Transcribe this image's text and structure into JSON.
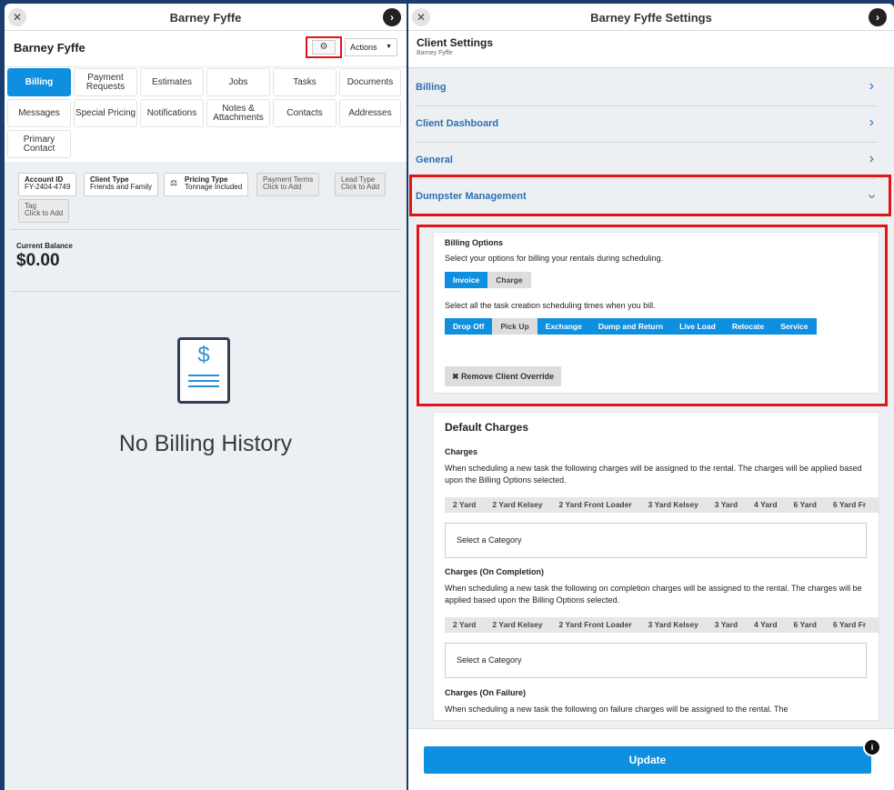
{
  "left": {
    "title": "Barney Fyffe",
    "header_name": "Barney Fyffe",
    "actions_label": "Actions",
    "tabs": [
      "Billing",
      "Payment Requests",
      "Estimates",
      "Jobs",
      "Tasks",
      "Documents",
      "Messages",
      "Special Pricing",
      "Notifications",
      "Notes & Attachments",
      "Contacts",
      "Addresses",
      "Primary Contact"
    ],
    "chips": [
      {
        "label": "Account ID",
        "value": "FY-2404-4749"
      },
      {
        "label": "Client Type",
        "value": "Friends and Family"
      },
      {
        "label": "Pricing Type",
        "value": "Tonnage Included"
      },
      {
        "label": "Payment Terms",
        "value": "Click to Add"
      },
      {
        "label": "Lead Type",
        "value": "Click to Add"
      },
      {
        "label": "Tag",
        "value": "Click to Add"
      }
    ],
    "balance_label": "Current Balance",
    "balance_value": "$0.00",
    "empty_text": "No Billing History"
  },
  "right": {
    "title": "Barney Fyffe Settings",
    "header_title": "Client Settings",
    "header_sub": "Barney Fyffe",
    "sections": [
      "Billing",
      "Client Dashboard",
      "General",
      "Dumpster Management"
    ],
    "billing_options": {
      "heading": "Billing Options",
      "desc": "Select your options for billing your rentals during scheduling.",
      "modes": [
        "Invoice",
        "Charge"
      ],
      "times_desc": "Select all the task creation scheduling times when you bill.",
      "times": [
        "Drop Off",
        "Pick Up",
        "Exchange",
        "Dump and Return",
        "Live Load",
        "Relocate",
        "Service"
      ],
      "remove_label": "Remove Client Override"
    },
    "default_charges": {
      "heading": "Default Charges",
      "charges_h": "Charges",
      "charges_desc": "When scheduling a new task the following charges will be assigned to the rental. The charges will be applied based upon the Billing Options selected.",
      "completion_h": "Charges (On Completion)",
      "completion_desc": "When scheduling a new task the following on completion charges will be assigned to the rental. The charges will be applied based upon the Billing Options selected.",
      "failure_h": "Charges (On Failure)",
      "failure_desc": "When scheduling a new task the following on failure charges will be assigned to the rental. The",
      "sizes": [
        "2 Yard",
        "2 Yard Kelsey",
        "2 Yard Front Loader",
        "3 Yard Kelsey",
        "3 Yard",
        "4 Yard",
        "6 Yard",
        "6 Yard Fr"
      ],
      "select_placeholder": "Select a Category"
    },
    "update_label": "Update"
  },
  "icons": {
    "close": "close-icon",
    "forward": "chevron-right-icon",
    "gear": "gear-icon",
    "info": "info-icon",
    "doc": "billing-document-icon"
  },
  "colors": {
    "accent": "#0e8fe0",
    "link": "#2d6fb2",
    "highlight": "#e01616",
    "background": "#1a3d6e"
  }
}
